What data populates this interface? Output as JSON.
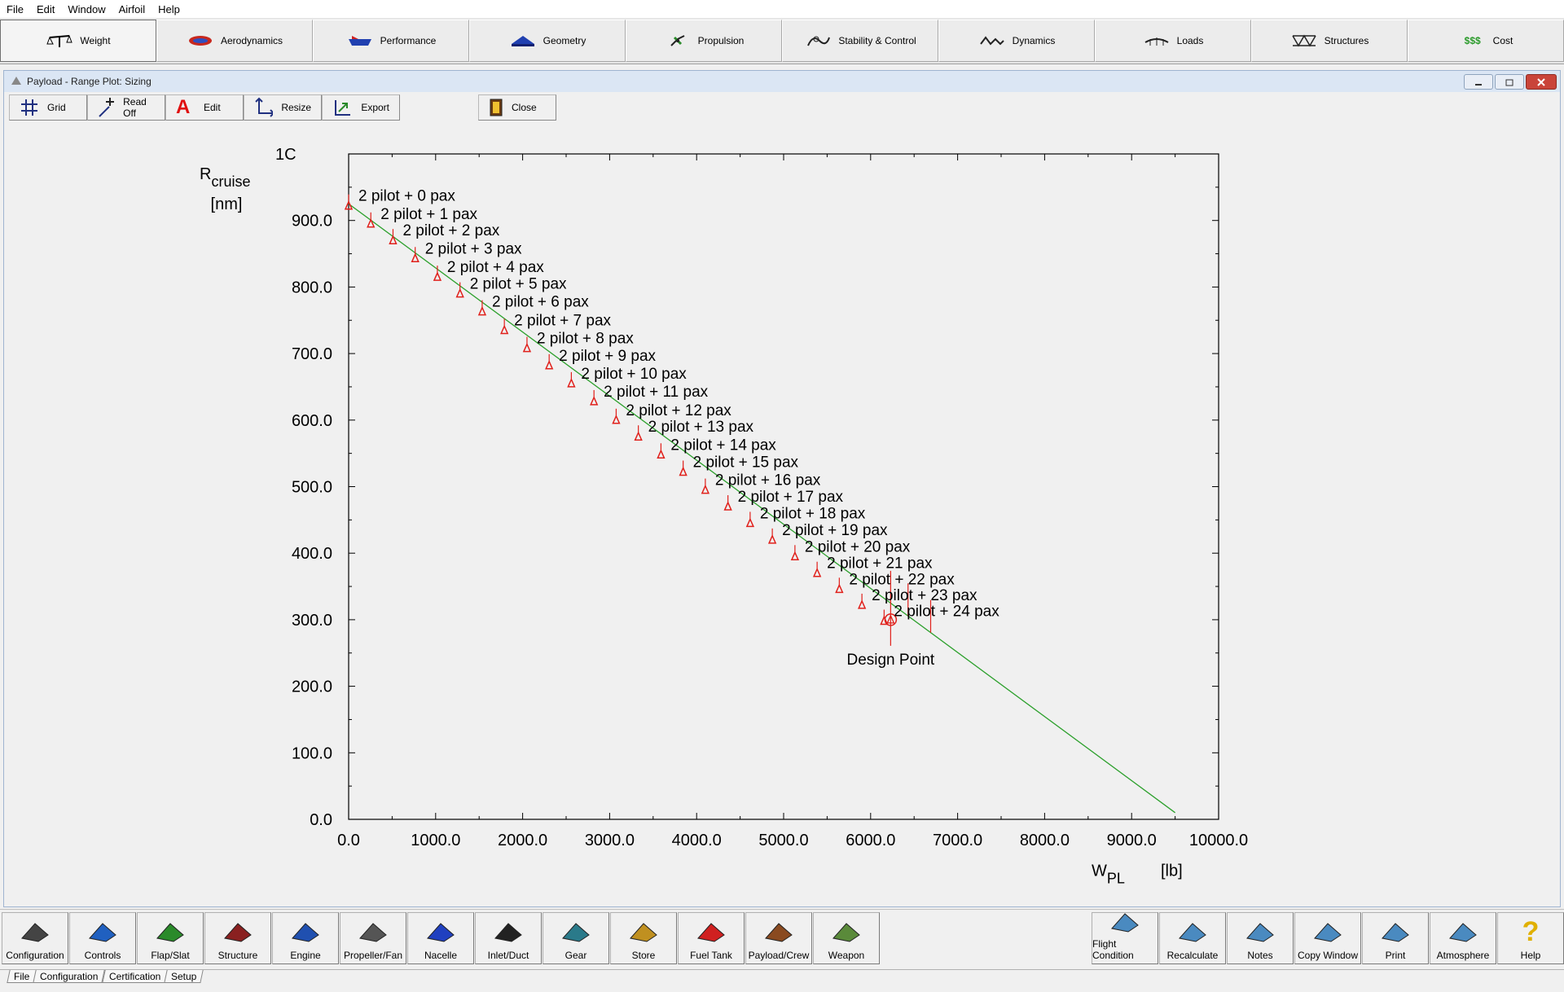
{
  "menu": [
    "File",
    "Edit",
    "Window",
    "Airfoil",
    "Help"
  ],
  "main_tabs": [
    {
      "label": "Weight",
      "icon": "scale-icon"
    },
    {
      "label": "Aerodynamics",
      "icon": "airfoil-icon"
    },
    {
      "label": "Performance",
      "icon": "performance-plane-icon"
    },
    {
      "label": "Geometry",
      "icon": "geometry-icon"
    },
    {
      "label": "Propulsion",
      "icon": "propeller-icon"
    },
    {
      "label": "Stability & Control",
      "icon": "stability-icon"
    },
    {
      "label": "Dynamics",
      "icon": "dynamics-wave-icon"
    },
    {
      "label": "Loads",
      "icon": "loads-icon"
    },
    {
      "label": "Structures",
      "icon": "truss-icon"
    },
    {
      "label": "Cost",
      "icon": "dollar-icon",
      "icon_text": "$$$"
    }
  ],
  "window": {
    "title": "Payload - Range Plot: Sizing",
    "toolbar": {
      "grid": "Grid",
      "readoff": "Read Off",
      "edit": "Edit",
      "edit_glyph": "A",
      "resize": "Resize",
      "export": "Export",
      "close": "Close"
    }
  },
  "chart_data": {
    "type": "line",
    "x_label": "W",
    "x_label_sub": "PL",
    "x_unit": "[lb]",
    "y_label": "R",
    "y_label_sub": "cruise",
    "y_unit": "[nm]",
    "xlim": [
      0,
      10000
    ],
    "ylim": [
      0,
      1000
    ],
    "x_ticks": [
      "0.0",
      "1000.0",
      "2000.0",
      "3000.0",
      "4000.0",
      "5000.0",
      "6000.0",
      "7000.0",
      "8000.0",
      "9000.0",
      "10000.0"
    ],
    "y_ticks": [
      "0.0",
      "100.0",
      "200.0",
      "300.0",
      "400.0",
      "500.0",
      "600.0",
      "700.0",
      "800.0",
      "900.0"
    ],
    "y_top_tick_fragment": "1C",
    "line": {
      "x": [
        0,
        9500
      ],
      "y": [
        925,
        10
      ],
      "color": "#2ca02c"
    },
    "points": [
      {
        "label": "2 pilot + 0 pax",
        "x": 0,
        "y": 922
      },
      {
        "label": "2 pilot + 1 pax",
        "x": 255,
        "y": 895
      },
      {
        "label": "2 pilot + 2 pax",
        "x": 510,
        "y": 870
      },
      {
        "label": "2 pilot + 3 pax",
        "x": 765,
        "y": 843
      },
      {
        "label": "2 pilot + 4 pax",
        "x": 1020,
        "y": 815
      },
      {
        "label": "2 pilot + 5 pax",
        "x": 1280,
        "y": 790
      },
      {
        "label": "2 pilot + 6 pax",
        "x": 1535,
        "y": 763
      },
      {
        "label": "2 pilot + 7 pax",
        "x": 1790,
        "y": 735
      },
      {
        "label": "2 pilot + 8 pax",
        "x": 2050,
        "y": 708
      },
      {
        "label": "2 pilot + 9 pax",
        "x": 2305,
        "y": 682
      },
      {
        "label": "2 pilot + 10 pax",
        "x": 2560,
        "y": 655
      },
      {
        "label": "2 pilot + 11 pax",
        "x": 2820,
        "y": 628
      },
      {
        "label": "2 pilot + 12 pax",
        "x": 3075,
        "y": 600
      },
      {
        "label": "2 pilot + 13 pax",
        "x": 3330,
        "y": 575
      },
      {
        "label": "2 pilot + 14 pax",
        "x": 3590,
        "y": 548
      },
      {
        "label": "2 pilot + 15 pax",
        "x": 3845,
        "y": 522
      },
      {
        "label": "2 pilot + 16 pax",
        "x": 4100,
        "y": 495
      },
      {
        "label": "2 pilot + 17 pax",
        "x": 4360,
        "y": 470
      },
      {
        "label": "2 pilot + 18 pax",
        "x": 4615,
        "y": 445
      },
      {
        "label": "2 pilot + 19 pax",
        "x": 4870,
        "y": 420
      },
      {
        "label": "2 pilot + 20 pax",
        "x": 5130,
        "y": 395
      },
      {
        "label": "2 pilot + 21 pax",
        "x": 5385,
        "y": 370
      },
      {
        "label": "2 pilot + 22 pax",
        "x": 5640,
        "y": 346
      },
      {
        "label": "2 pilot + 23 pax",
        "x": 5900,
        "y": 322
      },
      {
        "label": "2 pilot + 24 pax",
        "x": 6155,
        "y": 298
      }
    ],
    "design_point": {
      "label": "Design Point",
      "x": 6230,
      "y": 300
    },
    "marker_color": "#e0201b"
  },
  "bottom_buttons_left": [
    {
      "label": "Configuration",
      "icon": "configuration-icon"
    },
    {
      "label": "Controls",
      "icon": "controls-icon"
    },
    {
      "label": "Flap/Slat",
      "icon": "flap-slat-icon"
    },
    {
      "label": "Structure",
      "icon": "structure-icon"
    },
    {
      "label": "Engine",
      "icon": "engine-icon"
    },
    {
      "label": "Propeller/Fan",
      "icon": "propeller-fan-icon"
    },
    {
      "label": "Nacelle",
      "icon": "nacelle-icon"
    },
    {
      "label": "Inlet/Duct",
      "icon": "inlet-duct-icon"
    },
    {
      "label": "Gear",
      "icon": "gear-icon"
    },
    {
      "label": "Store",
      "icon": "store-icon"
    },
    {
      "label": "Fuel Tank",
      "icon": "fuel-tank-icon"
    },
    {
      "label": "Payload/Crew",
      "icon": "payload-crew-icon"
    },
    {
      "label": "Weapon",
      "icon": "weapon-icon"
    }
  ],
  "bottom_buttons_right": [
    {
      "label": "Flight Condition",
      "icon": "flight-condition-icon"
    },
    {
      "label": "Recalculate",
      "icon": "recalculate-icon"
    },
    {
      "label": "Notes",
      "icon": "notes-icon"
    },
    {
      "label": "Copy Window",
      "icon": "copy-window-icon"
    },
    {
      "label": "Print",
      "icon": "printer-icon"
    },
    {
      "label": "Atmosphere",
      "icon": "atmosphere-icon"
    },
    {
      "label": "Help",
      "icon": "help-icon",
      "icon_text": "?"
    }
  ],
  "sheet_tabs": [
    "File",
    "Configuration",
    "Certification",
    "Setup"
  ]
}
